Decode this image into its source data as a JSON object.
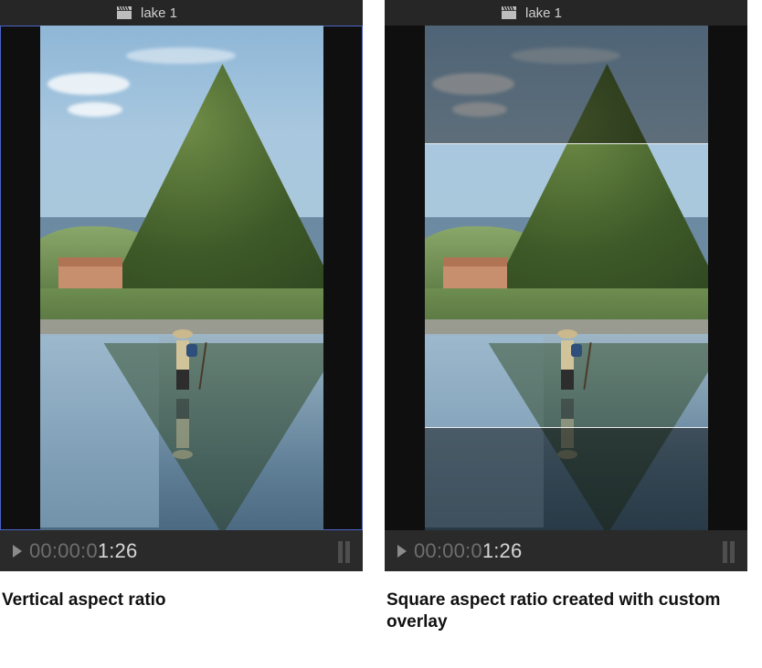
{
  "left": {
    "clip_title": "lake 1",
    "timecode_dim": "00:00:0",
    "timecode_bright": "1:26",
    "caption": "Vertical aspect ratio",
    "clapper_icon": "clapperboard-icon",
    "play_icon": "play-icon"
  },
  "right": {
    "clip_title": "lake 1",
    "timecode_dim": "00:00:0",
    "timecode_bright": "1:26",
    "caption": "Square aspect ratio created with custom overlay",
    "clapper_icon": "clapperboard-icon",
    "play_icon": "play-icon"
  }
}
